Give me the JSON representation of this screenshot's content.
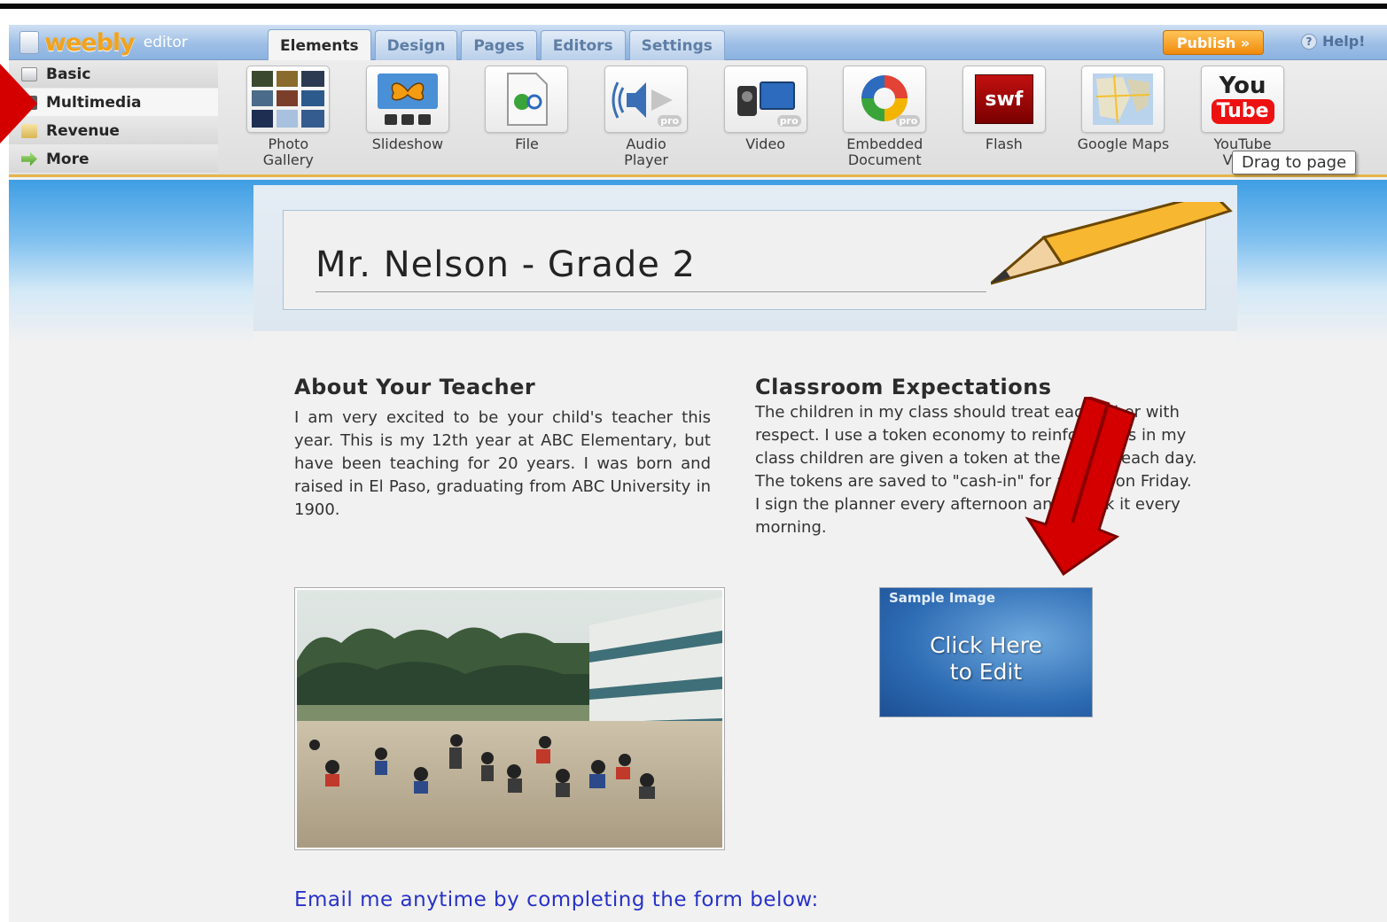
{
  "app": {
    "logo": "weebly",
    "logo_sub": "editor"
  },
  "tabs": [
    {
      "label": "Elements",
      "active": true
    },
    {
      "label": "Design"
    },
    {
      "label": "Pages"
    },
    {
      "label": "Editors"
    },
    {
      "label": "Settings"
    }
  ],
  "header_actions": {
    "publish": "Publish »",
    "help": "Help!"
  },
  "categories": [
    {
      "label": "Basic",
      "icon": "page-icon"
    },
    {
      "label": "Multimedia",
      "icon": "film-icon",
      "active": true
    },
    {
      "label": "Revenue",
      "icon": "folder-icon"
    },
    {
      "label": "More",
      "icon": "arrow-right-icon"
    }
  ],
  "elements": [
    {
      "label": "Photo\nGallery",
      "icon": "photo-gallery-icon"
    },
    {
      "label": "Slideshow",
      "icon": "slideshow-icon"
    },
    {
      "label": "File",
      "icon": "file-icon"
    },
    {
      "label": "Audio\nPlayer",
      "icon": "audio-player-icon",
      "badge": "pro"
    },
    {
      "label": "Video",
      "icon": "video-camera-icon",
      "badge": "pro"
    },
    {
      "label": "Embedded\nDocument",
      "icon": "embedded-document-icon",
      "badge": "pro"
    },
    {
      "label": "Flash",
      "icon": "flash-icon",
      "icon_text": "swf"
    },
    {
      "label": "Google Maps",
      "icon": "google-maps-icon"
    },
    {
      "label": "YouTube\nVideo",
      "icon": "youtube-icon",
      "icon_text_1": "You",
      "icon_text_2": "Tube"
    }
  ],
  "tooltip": "Drag to page",
  "page": {
    "site_title": "Mr. Nelson - Grade 2",
    "about": {
      "heading": "About Your Teacher",
      "body": "I am very excited to be your child's teacher this year. This is my 12th year at ABC Elementary, but have been teaching for 20 years. I was born and raised in El Paso, graduating from ABC University in 1900."
    },
    "expectations": {
      "heading": "Classroom Expectations",
      "body": "The children in my class should treat each other with respect. I use a token economy to reinforce this in my class children are given a token at the end of each day. The tokens are saved to \"cash-in\" for a prize on Friday. I sign the planner every afternoon and check it every morning."
    },
    "sample_image": {
      "label": "Sample Image",
      "text": "Click Here\nto Edit"
    },
    "email_line": "Email me anytime by completing the form below:"
  },
  "colors": {
    "accent_orange": "#f08a0c",
    "link_blue": "#2832c8",
    "annotation_red": "#d40000"
  }
}
